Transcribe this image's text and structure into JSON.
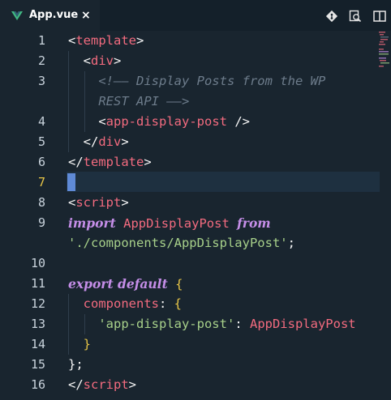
{
  "tab": {
    "title": "App.vue",
    "close": "×"
  },
  "toolbar": {
    "icons": [
      "git-compare-icon",
      "search-file-icon",
      "split-editor-icon"
    ]
  },
  "editor": {
    "active_line": "7",
    "lines": [
      {
        "num": "1",
        "tokens": [
          {
            "t": "<",
            "c": "punct"
          },
          {
            "t": "template",
            "c": "tag"
          },
          {
            "t": ">",
            "c": "punct"
          }
        ]
      },
      {
        "num": "2",
        "tokens": [
          {
            "t": "  <",
            "c": "punct"
          },
          {
            "t": "div",
            "c": "tag"
          },
          {
            "t": ">",
            "c": "punct"
          }
        ]
      },
      {
        "num": "3",
        "tokens": [
          {
            "t": "    <!—— Display Posts from the WP",
            "c": "comment"
          }
        ]
      },
      {
        "num": "",
        "tokens": [
          {
            "t": "    REST API ——>",
            "c": "comment"
          }
        ]
      },
      {
        "num": "4",
        "tokens": [
          {
            "t": "    <",
            "c": "punct"
          },
          {
            "t": "app-display-post",
            "c": "tag"
          },
          {
            "t": " />",
            "c": "punct"
          }
        ]
      },
      {
        "num": "5",
        "tokens": [
          {
            "t": "  </",
            "c": "punct"
          },
          {
            "t": "div",
            "c": "tag"
          },
          {
            "t": ">",
            "c": "punct"
          }
        ]
      },
      {
        "num": "6",
        "tokens": [
          {
            "t": "</",
            "c": "punct"
          },
          {
            "t": "template",
            "c": "tag"
          },
          {
            "t": ">",
            "c": "punct"
          }
        ]
      },
      {
        "num": "7",
        "tokens": []
      },
      {
        "num": "8",
        "tokens": [
          {
            "t": "<",
            "c": "punct"
          },
          {
            "t": "script",
            "c": "tag"
          },
          {
            "t": ">",
            "c": "punct"
          }
        ]
      },
      {
        "num": "9",
        "tokens": [
          {
            "t": "import",
            "c": "keyword"
          },
          {
            "t": " AppDisplayPost ",
            "c": "class"
          },
          {
            "t": "from",
            "c": "keyword"
          }
        ]
      },
      {
        "num": "",
        "tokens": [
          {
            "t": "'./components/AppDisplayPost'",
            "c": "string"
          },
          {
            "t": ";",
            "c": "punct"
          }
        ]
      },
      {
        "num": "10",
        "tokens": []
      },
      {
        "num": "11",
        "tokens": [
          {
            "t": "export default",
            "c": "keyword"
          },
          {
            "t": " {",
            "c": "brace"
          }
        ]
      },
      {
        "num": "12",
        "tokens": [
          {
            "t": "  components",
            "c": "prop"
          },
          {
            "t": ": ",
            "c": "punct"
          },
          {
            "t": "{",
            "c": "brace"
          }
        ]
      },
      {
        "num": "13",
        "tokens": [
          {
            "t": "    'app-display-post'",
            "c": "string"
          },
          {
            "t": ": ",
            "c": "punct"
          },
          {
            "t": "AppDisplayPost",
            "c": "class"
          }
        ]
      },
      {
        "num": "14",
        "tokens": [
          {
            "t": "  }",
            "c": "brace"
          }
        ]
      },
      {
        "num": "15",
        "tokens": [
          {
            "t": "};",
            "c": "punct"
          }
        ]
      },
      {
        "num": "16",
        "tokens": [
          {
            "t": "</",
            "c": "punct"
          },
          {
            "t": "script",
            "c": "tag"
          },
          {
            "t": ">",
            "c": "punct"
          }
        ]
      }
    ]
  }
}
